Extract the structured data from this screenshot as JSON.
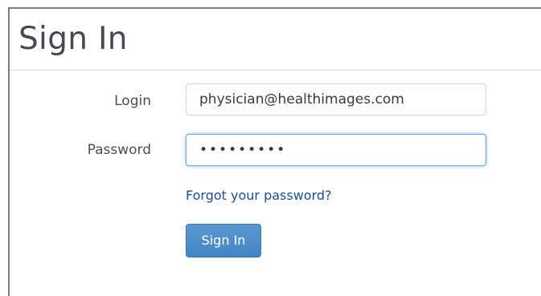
{
  "page": {
    "title": "Sign In"
  },
  "form": {
    "login_label": "Login",
    "login_value": "physician@healthimages.com",
    "password_label": "Password",
    "password_value": "•••••••••",
    "forgot_link": "Forgot your password?",
    "submit_label": "Sign In"
  },
  "colors": {
    "accent": "#4a8ccb",
    "link": "#1c4f8f",
    "focus_border": "#6fa8dc"
  }
}
